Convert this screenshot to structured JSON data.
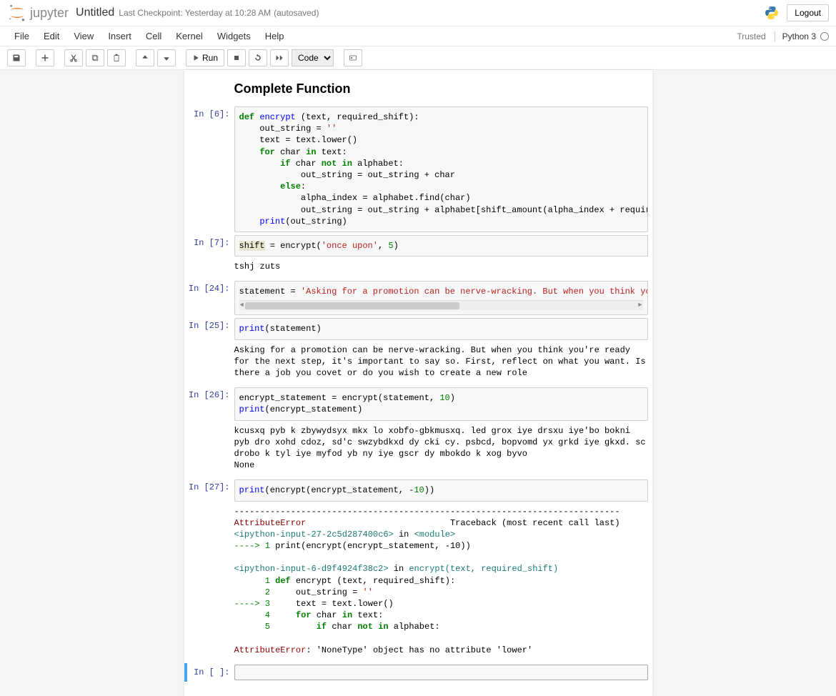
{
  "header": {
    "logo_text": "jupyter",
    "title": "Untitled",
    "checkpoint": "Last Checkpoint: Yesterday at 10:28 AM",
    "autosave": "(autosaved)",
    "logout": "Logout"
  },
  "menu": {
    "items": [
      "File",
      "Edit",
      "View",
      "Insert",
      "Cell",
      "Kernel",
      "Widgets",
      "Help"
    ],
    "trusted": "Trusted",
    "kernel": "Python 3"
  },
  "toolbar": {
    "run_label": "Run",
    "celltype": "Code"
  },
  "notebook": {
    "heading": "Complete Function",
    "cells": [
      {
        "prompt": "In [6]:",
        "code_html": "<span class='kw'>def</span> <span class='fn'>encrypt</span> (text, required_shift):\n    out_string = <span class='str'>''</span>\n    text = text.lower()\n    <span class='kw'>for</span> char <span class='kw'>in</span> text:\n        <span class='kw'>if</span> char <span class='kw'>not</span> <span class='kw'>in</span> alphabet:\n            out_string = out_string + char\n        <span class='kw'>else</span>:\n            alpha_index = alphabet.find(char)\n            out_string = out_string + alphabet[shift_amount(alpha_index + required_shift)]\n    <span class='fn'>print</span>(out_string)"
      },
      {
        "prompt": "In [7]:",
        "code_html": "<span style='background:#e8e8d0;'>shift</span> = encrypt(<span class='str'>'once upon'</span>, <span class='num'>5</span>)",
        "output": "tshj zuts"
      },
      {
        "prompt": "In [24]:",
        "code_html": "statement = <span class='str'>'Asking for a promotion can be nerve-wracking. But when you think you're ready for the next step, it's important to </span>",
        "scrollbar": true
      },
      {
        "prompt": "In [25]:",
        "code_html": "<span class='fn'>print</span>(statement)",
        "output": "Asking for a promotion can be nerve-wracking. But when you think you're ready for the next step, it's important to say so. First, reflect on what you want. Is there a job you covet or do you wish to create a new role"
      },
      {
        "prompt": "In [26]:",
        "code_html": "encrypt_statement = encrypt(statement, <span class='num'>10</span>)\n<span class='fn'>print</span>(encrypt_statement)",
        "output": "kcusxq pyb k zbywydsyx mkx lo xobfo-gbkmusxq. led grox iye drsxu iye'bo bokni pyb dro xohd cdoz, sd'c swzybdkxd dy cki cy. psbcd, bopvomd yx grkd iye gkxd. sc drobo k tyl iye myfod yb ny iye gscr dy mbokdo k xog byvo\nNone"
      },
      {
        "prompt": "In [27]:",
        "code_html": "<span class='fn'>print</span>(encrypt(encrypt_statement, -<span class='num'>10</span>))",
        "traceback_html": "---------------------------------------------------------------------------\n<span class='err-name'>AttributeError</span>                            Traceback (most recent call last)\n<span class='err-cyan'>&lt;ipython-input-27-2c5d287400c6&gt;</span> in <span class='err-cyan'>&lt;module&gt;</span>\n<span class='err-green'>----&gt; 1</span> print(encrypt(encrypt_statement, -10))\n\n<span class='err-cyan'>&lt;ipython-input-6-d9f4924f38c2&gt;</span> in <span class='err-cyan'>encrypt</span><span class='err-cyan'>(text, required_shift)</span>\n      <span class='err-green'>1</span> <span class='kw'>def</span> encrypt (text, required_shift):\n      <span class='err-green'>2</span>     out_string = <span class='str'>''</span>\n<span class='err-green'>----&gt; 3</span>     text = text.lower()\n      <span class='err-green'>4</span>     <span class='kw'>for</span> char <span class='kw'>in</span> text:\n      <span class='err-green'>5</span>         <span class='kw'>if</span> char <span class='kw'>not</span> <span class='kw'>in</span> alphabet:\n\n<span class='err-name'>AttributeError</span>: 'NoneType' object has no attribute 'lower'"
      },
      {
        "prompt": "In [ ]:",
        "code_html": "",
        "selected": true
      }
    ]
  }
}
